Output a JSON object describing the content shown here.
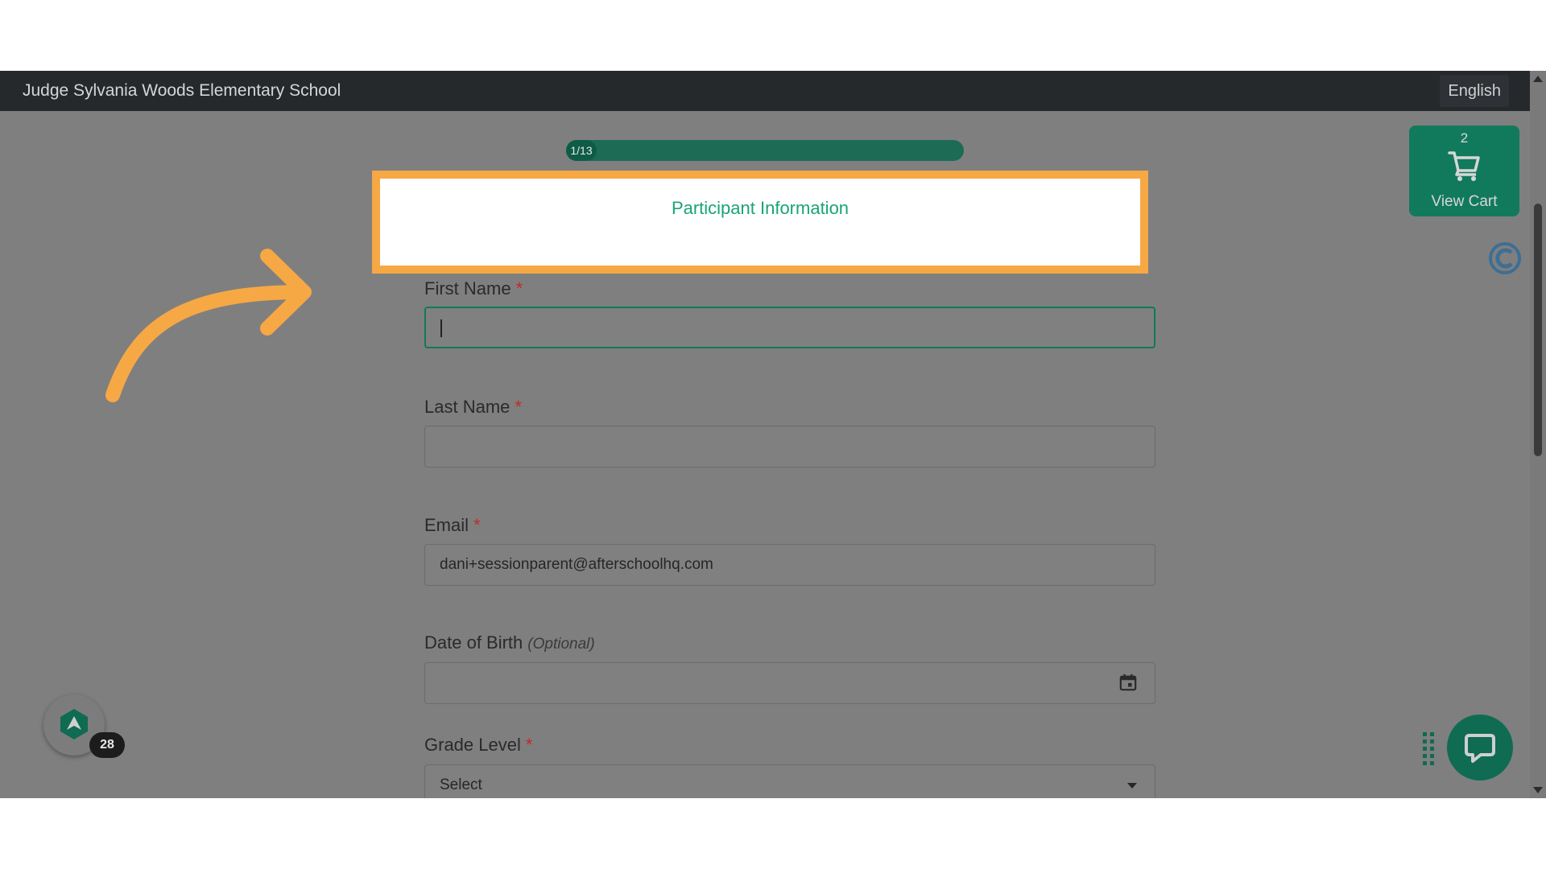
{
  "header": {
    "school_name": "Judge Sylvania Woods Elementary School",
    "language": "English"
  },
  "progress": {
    "label": "1/13",
    "current": 1,
    "total": 13
  },
  "section": {
    "title": "Participant Information"
  },
  "form": {
    "first_name": {
      "label": "First Name",
      "required_mark": "*",
      "value": ""
    },
    "last_name": {
      "label": "Last Name",
      "required_mark": "*",
      "value": ""
    },
    "email": {
      "label": "Email",
      "required_mark": "*",
      "value": "dani+sessionparent@afterschoolhq.com"
    },
    "dob": {
      "label": "Date of Birth",
      "optional_note": "(Optional)",
      "value": ""
    },
    "grade": {
      "label": "Grade Level",
      "required_mark": "*",
      "selected": "Select"
    }
  },
  "cart": {
    "count": "2",
    "label": "View Cart",
    "icon": "cart-icon"
  },
  "notifications": {
    "count": "28"
  },
  "colors": {
    "accent": "#127a5c",
    "highlight": "#f6a845",
    "title": "#19a37a",
    "topbar": "#25292c"
  }
}
